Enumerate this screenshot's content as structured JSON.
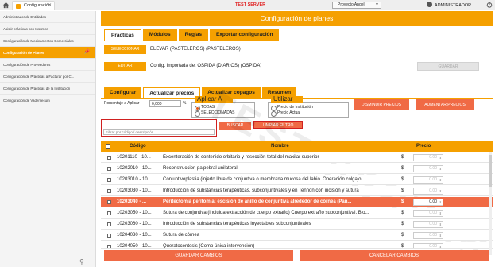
{
  "topbar": {
    "app_tab": "Configuración",
    "close_glyph": "✕",
    "server_label": "TEST SERVER",
    "project_selected": "Proyecto Angel",
    "user": "ADMINISTRADOR"
  },
  "sidebar": {
    "items": [
      {
        "label": "Administrador de Entidades"
      },
      {
        "label": "Asistir prácticas con Insumos"
      },
      {
        "label": "Configuración de Medicamentos Comerciales"
      },
      {
        "label": "Configuración de Planes"
      },
      {
        "label": "Configuración de Proveedores"
      },
      {
        "label": "Configuración de Prácticas a Facturar por C..."
      },
      {
        "label": "Configuración de Prácticas de la Institución"
      },
      {
        "label": "Configuración de Vademecum"
      }
    ],
    "active_index": 3,
    "pin_glyph": "📌"
  },
  "main": {
    "title": "Configuración de planes",
    "tabs": [
      {
        "label": "Prácticas"
      },
      {
        "label": "Módulos"
      },
      {
        "label": "Reglas"
      },
      {
        "label": "Exportar configuración"
      }
    ],
    "select_button": "SELECCIONAR",
    "plan_name": "ELEVAR (PASTELEROS) (PASTELEROS)",
    "edit_button": "EDITAR",
    "config_label": "Config. Importada de: OSPIDA (DIARIOS) (OSPIDA)",
    "save_button": "GUARDAR",
    "subtabs": [
      {
        "label": "Configurar"
      },
      {
        "label": "Actualizar precios"
      },
      {
        "label": "Actualizar copagos"
      },
      {
        "label": "Resumen"
      }
    ],
    "percent_label": "Porcentaje a Aplicar",
    "percent_value": "0,000",
    "percent_sign": "%",
    "apply_group": {
      "title": "Aplicar A",
      "options": [
        "TODAS",
        "SELECCIONADAS"
      ],
      "selected": 0
    },
    "use_group": {
      "title": "Utilizar",
      "options": [
        "Precio de Institución",
        "Precio Actual"
      ],
      "selected": -1
    },
    "decrease_button": "DISMINUIR PRECIOS",
    "increase_button": "AUMENTAR PRECIOS",
    "search_button": "BUSCAR",
    "clear_filter_button": "LIMPIAR FILTRO",
    "filter_placeholder": "Filtrar por código / descripción",
    "watermark": "TEST SERVER",
    "table": {
      "headers": {
        "code": "Código",
        "name": "Nombre",
        "price": "Precio"
      },
      "rows": [
        {
          "code": "10201110 - 10...",
          "name": "Excenteración de contenido orbitario y resección total del maxilar superior",
          "currency": "$",
          "price": "0.00",
          "selected": false
        },
        {
          "code": "10202010 - 10...",
          "name": "Reconstruccion palpebral unilateral",
          "currency": "$",
          "price": "0.00",
          "selected": false
        },
        {
          "code": "10203010 - 10...",
          "name": "Conjuntivoplastia (injerto libre de conjuntiva o membrana mucosa del labio. Operación colgajo: ...",
          "currency": "$",
          "price": "0.00",
          "selected": false
        },
        {
          "code": "10203030 - 10...",
          "name": "Introducción de substancias terapéuticas, subconjuntivales y en Tennon con incisión y sutura",
          "currency": "$",
          "price": "0.00",
          "selected": false
        },
        {
          "code": "10203040 - ...",
          "name": "Peritectomía peritomía; escisión de anillo de conjuntiva alrededor de córnea (Pan...",
          "currency": "$",
          "price": "0.00",
          "selected": true
        },
        {
          "code": "10203050 - 10...",
          "name": "Sutura de conjuntiva (incluida extracción de cuerpo extraño) Cuerpo extraño subconjuntival. Bio...",
          "currency": "$",
          "price": "0.00",
          "selected": false
        },
        {
          "code": "10203060 - 10...",
          "name": "Introducción de substancias terapéuticas inyectables subconjuntivales",
          "currency": "$",
          "price": "0.00",
          "selected": false
        },
        {
          "code": "10204030 - 10...",
          "name": "Sutura de córnea",
          "currency": "$",
          "price": "0.00",
          "selected": false
        },
        {
          "code": "10204050 - 10...",
          "name": "Queratocentesis (Como única intervención)",
          "currency": "$",
          "price": "0.00",
          "selected": false
        }
      ]
    },
    "save_changes_button": "GUARDAR CAMBIOS",
    "cancel_changes_button": "CANCELAR CAMBIOS"
  },
  "colors": {
    "accent": "#f5a000",
    "highlight": "#f06a45",
    "server_red": "#e02020"
  }
}
